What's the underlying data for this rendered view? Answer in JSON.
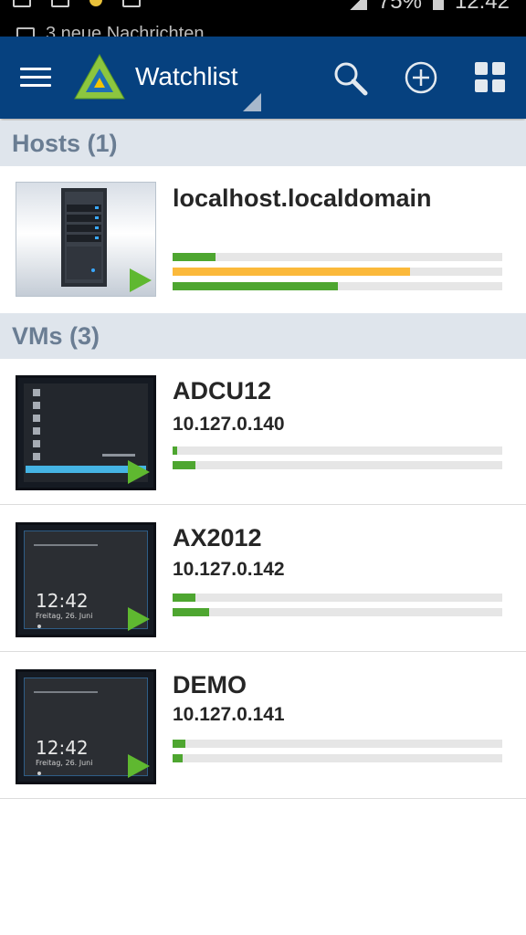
{
  "statusbar": {
    "battery": "75%",
    "time": "12:42",
    "notification": "3 neue Nachrichten"
  },
  "appbar": {
    "title": "Watchlist",
    "icons": [
      "menu-icon",
      "app-logo",
      "dropdown-arrow-icon",
      "search-icon",
      "add-icon",
      "grid-icon"
    ]
  },
  "hosts": {
    "header": "Hosts (1)",
    "items": [
      {
        "name": "localhost.localdomain",
        "usage": [
          0.13,
          0.72,
          0.5
        ],
        "colors": [
          "#4ea630",
          "#fbb93b",
          "#4ea630"
        ]
      }
    ]
  },
  "vms": {
    "header": "VMs (3)",
    "items": [
      {
        "name": "ADCU12",
        "ip": "10.127.0.140",
        "usage": [
          0.015,
          0.07
        ],
        "screen": "desktop"
      },
      {
        "name": "AX2012",
        "ip": "10.127.0.142",
        "usage": [
          0.07,
          0.11
        ],
        "screen": "lock",
        "lock_time": "12:42",
        "lock_date": "Freitag, 26. Juni"
      },
      {
        "name": "DEMO",
        "ip": "10.127.0.141",
        "usage": [
          0.04,
          0.03
        ],
        "screen": "lock",
        "lock_time": "12:42",
        "lock_date": "Freitag, 26. Juni"
      }
    ]
  },
  "colors": {
    "appbar": "#06417f",
    "section_header_bg": "#dfe5ec",
    "section_header_text": "#6a7d93",
    "bar_green": "#4ea630",
    "bar_orange": "#fbb93b",
    "bar_track": "#e6e6e6",
    "play_green": "#5fb830"
  }
}
